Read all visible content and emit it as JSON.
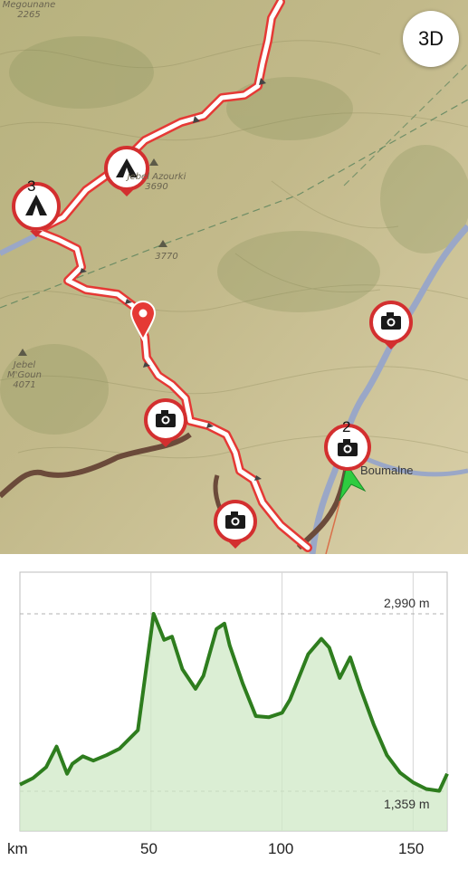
{
  "map": {
    "button_3d": "3D",
    "places": [
      {
        "name": "Megounane",
        "elev": "2265"
      },
      {
        "name": "Jebel Azourki",
        "elev": "3690"
      },
      {
        "name": "",
        "elev": "3770"
      },
      {
        "name": "Jebel M'Goun",
        "elev": "4071"
      }
    ],
    "town": "Boumalne",
    "markers": {
      "camp_numbered_count": "3",
      "camera_numbered_count": "2"
    },
    "colors": {
      "route": "#e53935",
      "marker_ring": "#d32f2f",
      "location_arrow": "#2ecc40",
      "road_brown": "#6b4a3a",
      "river": "#9aa7c7"
    },
    "icons": [
      "camp-icon",
      "camera-icon",
      "location-pin-icon",
      "direction-arrow-icon"
    ]
  },
  "elevation": {
    "max_label": "2,990 m",
    "min_label": "1,359 m",
    "unit": "km",
    "x_ticks": [
      "50",
      "100",
      "150"
    ],
    "colors": {
      "line": "#2e7d1e",
      "fill": "#cfe8c6"
    }
  },
  "chart_data": {
    "type": "area",
    "xlabel": "km",
    "ylabel": "",
    "xlim": [
      0,
      163
    ],
    "ylim": [
      1359,
      2990
    ],
    "grid": true,
    "series": [
      {
        "x": [
          0,
          5,
          10,
          14,
          18,
          20,
          24,
          28,
          33,
          38,
          45,
          51,
          55,
          58,
          62,
          67,
          70,
          75,
          78,
          80,
          85,
          90,
          95,
          100,
          103,
          110,
          115,
          118,
          122,
          126,
          130,
          135,
          140,
          145,
          150,
          155,
          160,
          163
        ],
        "y": [
          1420,
          1480,
          1580,
          1770,
          1520,
          1610,
          1680,
          1640,
          1690,
          1750,
          1920,
          2990,
          2750,
          2780,
          2480,
          2300,
          2420,
          2850,
          2900,
          2700,
          2350,
          2050,
          2040,
          2080,
          2200,
          2620,
          2760,
          2680,
          2400,
          2590,
          2300,
          1970,
          1690,
          1530,
          1440,
          1380,
          1362,
          1520
        ]
      }
    ]
  }
}
